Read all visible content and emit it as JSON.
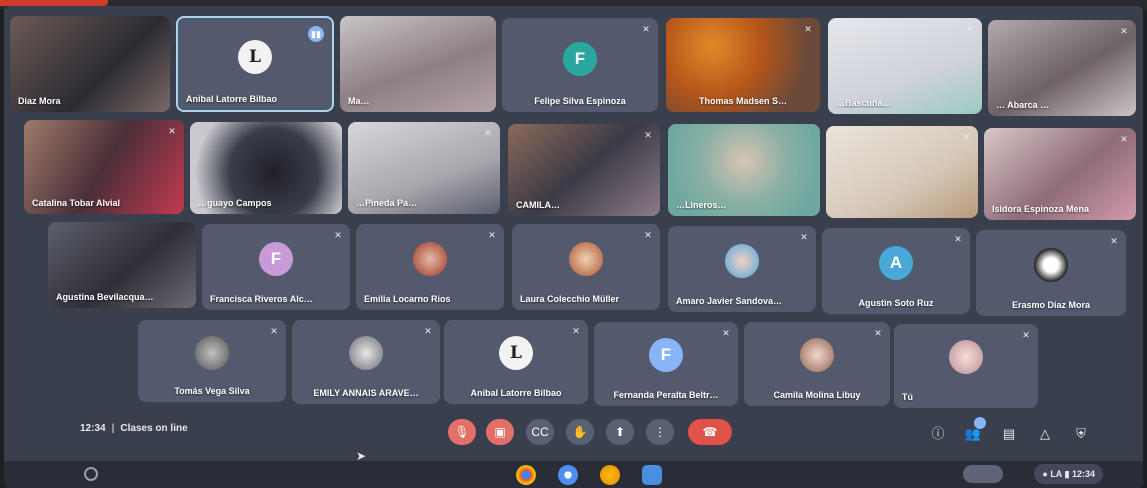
{
  "meeting": {
    "time": "12:34",
    "title": "Clases on line"
  },
  "participants": {
    "row1": [
      {
        "name": "Diaz Mora",
        "kind": "video"
      },
      {
        "name": "Anibal Latorre Bilbao",
        "kind": "avatar",
        "initial": "L",
        "active": true
      },
      {
        "name": "Ma…",
        "kind": "video"
      },
      {
        "name": "Felipe Silva Espinoza",
        "kind": "avatar",
        "initial": "F",
        "color": "#2aa7a0"
      },
      {
        "name": "Thomas Madsen S…",
        "kind": "video"
      },
      {
        "name": "…Bascuña…",
        "kind": "video"
      },
      {
        "name": "… Abarca …",
        "kind": "video"
      }
    ],
    "row2": [
      {
        "name": "Catalina Tobar Alvial",
        "kind": "video"
      },
      {
        "name": "…guayo Campos",
        "kind": "video"
      },
      {
        "name": "…Pineda Pa…",
        "kind": "video"
      },
      {
        "name": "CAMILA…",
        "kind": "video"
      },
      {
        "name": "…Lineros…",
        "kind": "video"
      },
      {
        "name": "",
        "kind": "video"
      },
      {
        "name": "Isidora Espinoza Mena",
        "kind": "video"
      }
    ],
    "row3": [
      {
        "name": "Agustina Bevilacqua…",
        "kind": "video"
      },
      {
        "name": "Francisca Riveros Alc…",
        "kind": "avatar",
        "initial": "F",
        "color": "#c89ad8"
      },
      {
        "name": "Emilia Locarno Rios",
        "kind": "photo"
      },
      {
        "name": "Laura Colecchio Müller",
        "kind": "photo"
      },
      {
        "name": "Amaro Javier Sandova…",
        "kind": "photo"
      },
      {
        "name": "Agustin Soto Ruz",
        "kind": "avatar",
        "initial": "A",
        "color": "#4aa8d8"
      },
      {
        "name": "Erasmo Diaz Mora",
        "kind": "photo"
      }
    ],
    "row4": [
      {
        "name": "Tomás Vega Silva",
        "kind": "photo"
      },
      {
        "name": "EMILY ANNAIS ARAVE…",
        "kind": "photo"
      },
      {
        "name": "Anibal Latorre Bilbao",
        "kind": "avatar",
        "initial": "L"
      },
      {
        "name": "Fernanda Peralta Beltr…",
        "kind": "avatar",
        "initial": "F",
        "color": "#8ab4f8"
      },
      {
        "name": "Camila Molina Libuy",
        "kind": "photo"
      },
      {
        "name": "Tú",
        "kind": "photo"
      }
    ]
  },
  "controls": {
    "mic_icon": "mic-off-icon",
    "camera_icon": "camera-off-icon",
    "captions_icon": "captions-icon",
    "hand_icon": "raise-hand-icon",
    "present_icon": "present-icon",
    "more_icon": "more-vert-icon",
    "end_icon": "end-call-icon"
  },
  "right_controls": {
    "info_icon": "info-icon",
    "people_icon": "people-icon",
    "people_count": "",
    "chat_icon": "chat-icon",
    "activities_icon": "activities-icon",
    "host_icon": "host-controls-icon"
  },
  "shelf": {
    "status_text": "LA",
    "clock": "12:34"
  },
  "colors": {
    "background": "#3a3f4e",
    "tile": "#545a6e",
    "end_call": "#e0524a",
    "muted_control": "#e46f66"
  }
}
